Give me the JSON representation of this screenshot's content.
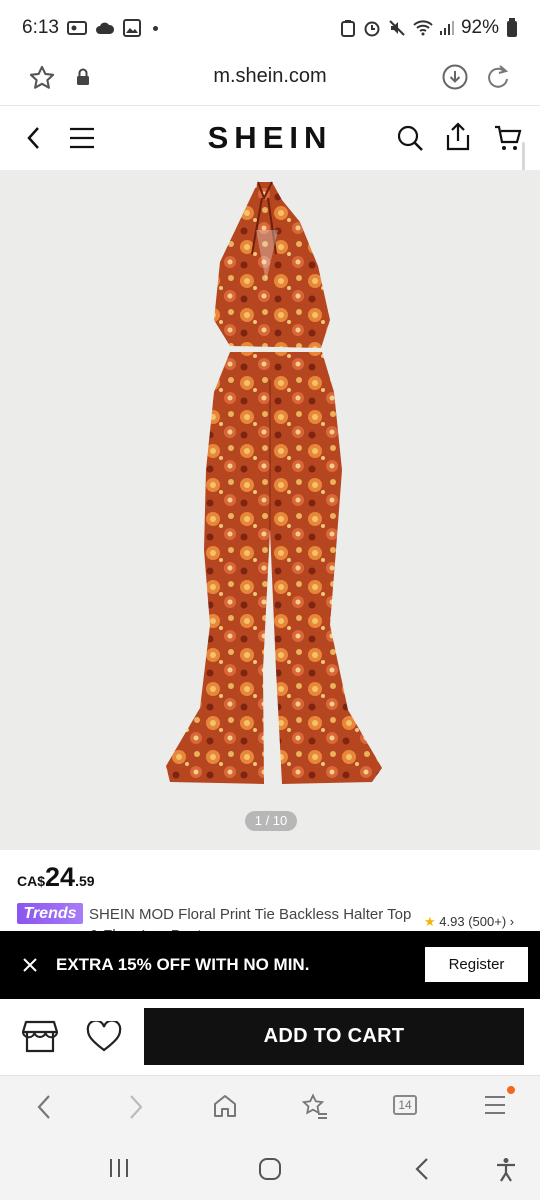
{
  "status_bar": {
    "time": "6:13",
    "battery": "92%"
  },
  "browser": {
    "url": "m.shein.com",
    "tabs_count": "14"
  },
  "header": {
    "logo": "SHEIN"
  },
  "gallery": {
    "counter": "1 / 10"
  },
  "product": {
    "currency": "CA$",
    "price_main": "24",
    "price_cents": ".59",
    "badge": "Trends",
    "title": "SHEIN MOD Floral Print Tie Backless Halter Top & Flare Leg Pants",
    "rating": "4.93",
    "reviews": "(500+)"
  },
  "promo": {
    "text": "EXTRA 15% OFF WITH NO MIN.",
    "register_label": "Register"
  },
  "actions": {
    "add_to_cart_label": "ADD TO CART"
  },
  "colors": {
    "accent_black": "#111111",
    "badge_purple": "#8a55f0",
    "rating_star": "#f5b400",
    "notification": "#f06a1f"
  }
}
